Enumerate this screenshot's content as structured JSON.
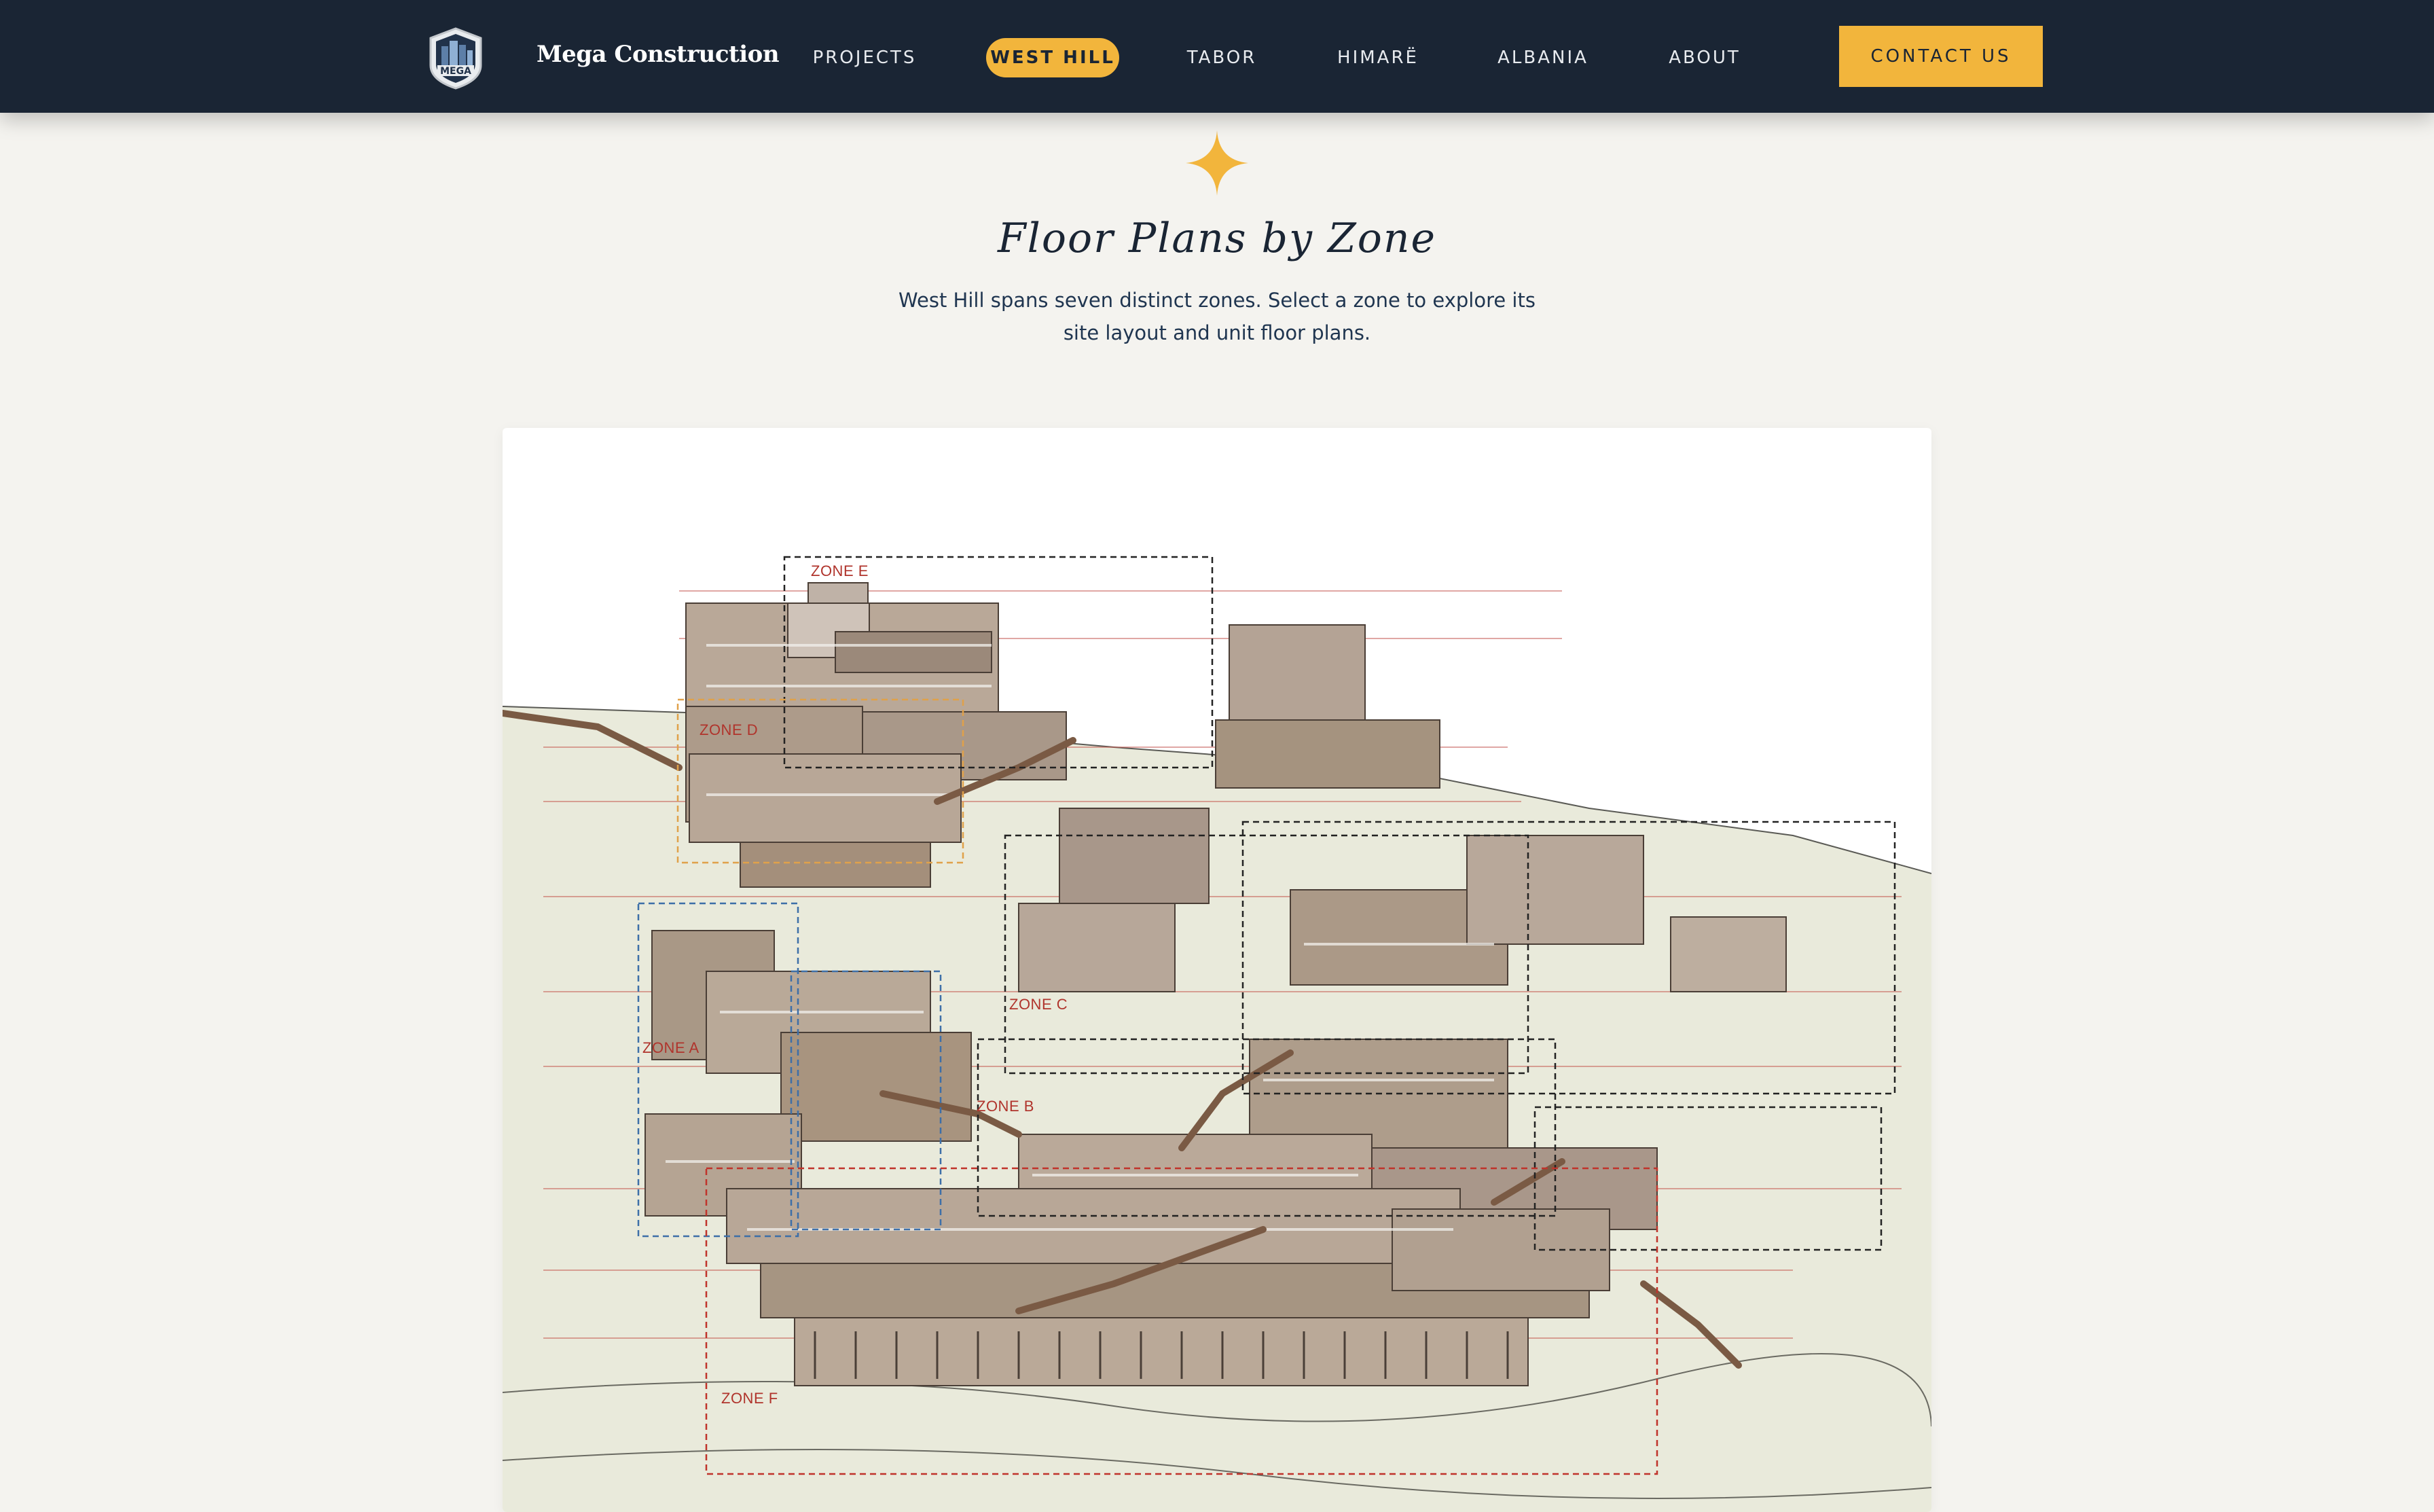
{
  "header": {
    "logo_text": "MEGA",
    "brand": "Mega Construction",
    "nav": [
      {
        "label": "PROJECTS",
        "active": false
      },
      {
        "label": "WEST HILL",
        "active": true
      },
      {
        "label": "TABOR",
        "active": false
      },
      {
        "label": "HIMARË",
        "active": false
      },
      {
        "label": "ALBANIA",
        "active": false
      },
      {
        "label": "ABOUT",
        "active": false
      }
    ],
    "contact_label": "CONTACT US"
  },
  "section": {
    "title": "Floor Plans by Zone",
    "description": "West Hill spans seven distinct zones. Select a zone to explore its site layout and unit floor plans."
  },
  "site_plan": {
    "zones": [
      "ZONE E",
      "ZONE D",
      "ZONE A",
      "ZONE C",
      "ZONE B",
      "ZONE F"
    ]
  },
  "colors": {
    "nav_bg": "#1a2534",
    "accent": "#f2b53c",
    "page_bg": "#f4f3ef",
    "ground": "#e9eadb",
    "building": "#a9988a",
    "zone_red": "#b0342c"
  }
}
